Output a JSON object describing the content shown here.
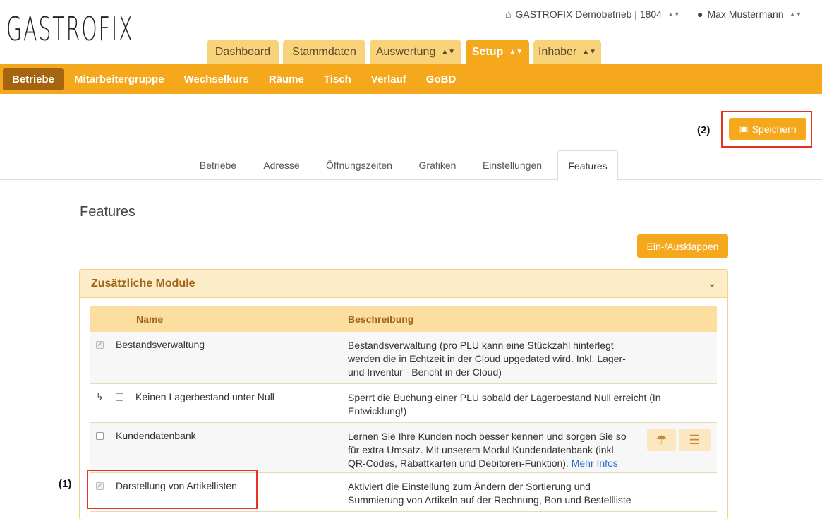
{
  "app": {
    "logo": "GASTROFIX"
  },
  "topbar": {
    "business": "GASTROFIX Demobetrieb | 1804",
    "user": "Max Mustermann"
  },
  "main_tabs": [
    {
      "label": "Dashboard",
      "has_arrows": false,
      "active": false
    },
    {
      "label": "Stammdaten",
      "has_arrows": false,
      "active": false
    },
    {
      "label": "Auswertung",
      "has_arrows": true,
      "active": false
    },
    {
      "label": "Setup",
      "has_arrows": true,
      "active": true
    },
    {
      "label": "Inhaber",
      "has_arrows": true,
      "active": false
    }
  ],
  "sub_nav": [
    "Betriebe",
    "Mitarbeitergruppe",
    "Wechselkurs",
    "Räume",
    "Tisch",
    "Verlauf",
    "GoBD"
  ],
  "save_button": "Speichern",
  "annotations": {
    "save": "(2)",
    "row": "(1)"
  },
  "page_tabs": [
    "Betriebe",
    "Adresse",
    "Öffnungszeiten",
    "Grafiken",
    "Einstellungen",
    "Features"
  ],
  "section": {
    "title": "Features",
    "toggle_button": "Ein-/Ausklappen"
  },
  "panel": {
    "title": "Zusätzliche Module",
    "columns": {
      "name": "Name",
      "description": "Beschreibung"
    },
    "rows": [
      {
        "name": "Bestandsverwaltung",
        "checked": true,
        "child": false,
        "description": "Bestandsverwaltung (pro PLU kann eine Stückzahl hinterlegt werden die in Echtzeit in der Cloud upgedated wird. Inkl. Lager- und Inventur - Bericht in der Cloud)",
        "link": ""
      },
      {
        "name": "Keinen Lagerbestand unter Null",
        "checked": false,
        "child": true,
        "description": "Sperrt die Buchung einer PLU sobald der Lagerbestand Null erreicht (In Entwicklung!)",
        "link": ""
      },
      {
        "name": "Kundendatenbank",
        "checked": false,
        "child": false,
        "description": "Lernen Sie Ihre Kunden noch besser kennen und sorgen Sie so für extra Umsatz. Mit unserem Modul Kundendatenbank (inkl. QR-Codes, Rabattkarten und Debitoren-Funktion).",
        "link": "Mehr Infos"
      },
      {
        "name": "Darstellung von Artikellisten",
        "checked": true,
        "child": false,
        "description": "Aktiviert die Einstellung zum Ändern der Sortierung und Summierung von Artikeln auf der Rechnung, Bon und Bestellliste",
        "link": ""
      }
    ]
  },
  "colors": {
    "accent": "#f6a81d",
    "accent_light": "#f9d37a",
    "active_sub": "#a46410",
    "highlight": "#e8311f"
  }
}
